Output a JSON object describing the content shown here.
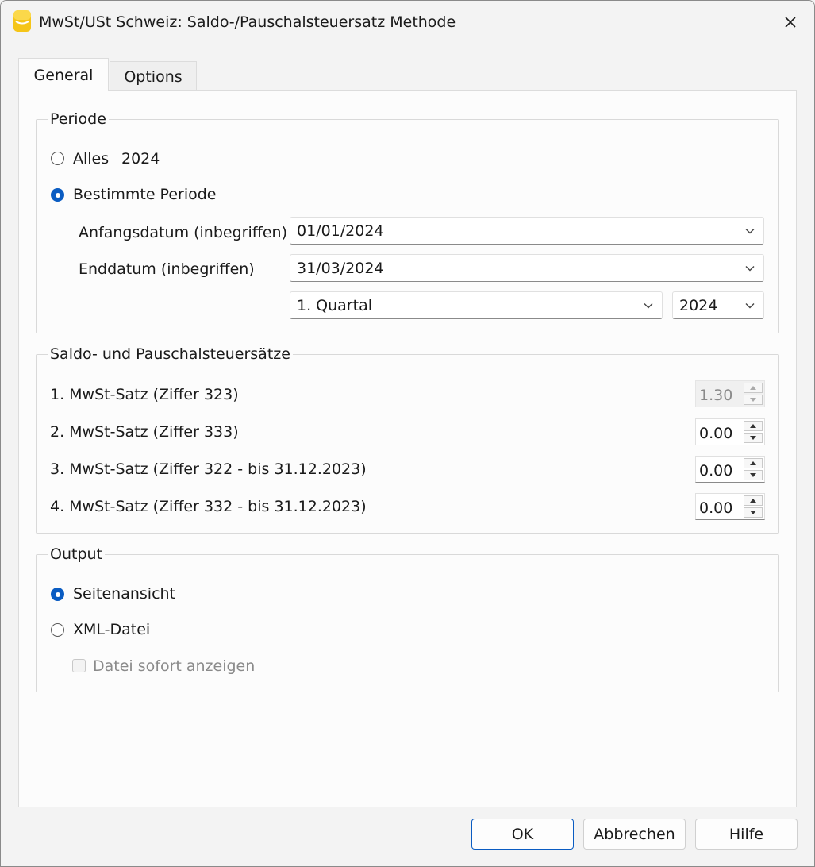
{
  "window": {
    "title": "MwSt/USt Schweiz: Saldo-/Pauschalsteuersatz Methode",
    "icon": "app-icon",
    "close_icon": "close-icon"
  },
  "tabs": [
    {
      "label": "General",
      "active": true
    },
    {
      "label": "Options",
      "active": false
    }
  ],
  "periode": {
    "legend": "Periode",
    "alles_label": "Alles",
    "alles_year": "2024",
    "alles_selected": false,
    "bestimmte_label": "Bestimmte Periode",
    "bestimmte_selected": true,
    "anfang_label": "Anfangsdatum (inbegriffen)",
    "anfang_value": "01/01/2024",
    "end_label": "Enddatum (inbegriffen)",
    "end_value": "31/03/2024",
    "period_value": "1. Quartal",
    "year_value": "2024"
  },
  "saetze": {
    "legend": "Saldo- und Pauschalsteuersätze",
    "rows": [
      {
        "label": "1. MwSt-Satz (Ziffer 323)",
        "value": "1.30",
        "disabled": true
      },
      {
        "label": "2. MwSt-Satz (Ziffer 333)",
        "value": "0.00",
        "disabled": false
      },
      {
        "label": "3. MwSt-Satz (Ziffer 322 - bis 31.12.2023)",
        "value": "0.00",
        "disabled": false
      },
      {
        "label": "4. MwSt-Satz (Ziffer 332 - bis 31.12.2023)",
        "value": "0.00",
        "disabled": false
      }
    ]
  },
  "output": {
    "legend": "Output",
    "seitenansicht_label": "Seitenansicht",
    "seitenansicht_selected": true,
    "xml_label": "XML-Datei",
    "xml_selected": false,
    "datei_label": "Datei sofort anzeigen",
    "datei_checked": false,
    "datei_disabled": true
  },
  "buttons": {
    "ok": "OK",
    "abbrechen": "Abbrechen",
    "hilfe": "Hilfe"
  },
  "colors": {
    "accent": "#0a5cc2",
    "app_icon": "#f5c518"
  }
}
